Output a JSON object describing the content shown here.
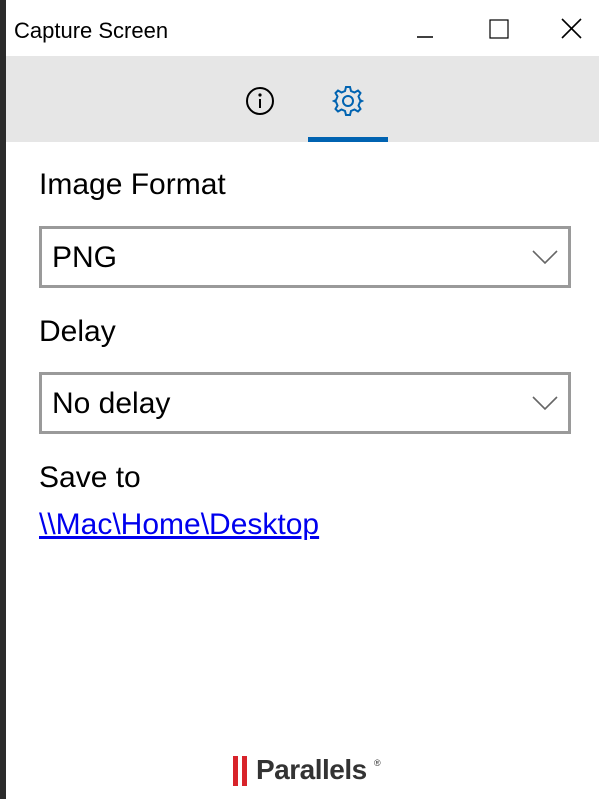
{
  "window": {
    "title": "Capture Screen"
  },
  "title_bar_buttons": {
    "minimize_icon": "minimize-icon",
    "maximize_icon": "maximize-icon",
    "close_icon": "close-icon"
  },
  "tabs": [
    {
      "name": "info",
      "icon": "info-icon",
      "active": false
    },
    {
      "name": "settings",
      "icon": "gear-icon",
      "active": true
    }
  ],
  "settings": {
    "image_format": {
      "label": "Image Format",
      "value": "PNG"
    },
    "delay": {
      "label": "Delay",
      "value": "No delay"
    },
    "save_to": {
      "label": "Save to",
      "path": "\\\\Mac\\Home\\Desktop"
    }
  },
  "footer": {
    "logo_text": "Parallels",
    "logo_mark": "®"
  },
  "colors": {
    "accent": "#0063b1",
    "tabbar_bg": "#e6e6e6",
    "select_border": "#9a9a9a",
    "link": "#0000ee",
    "logo_red": "#d8232a"
  }
}
